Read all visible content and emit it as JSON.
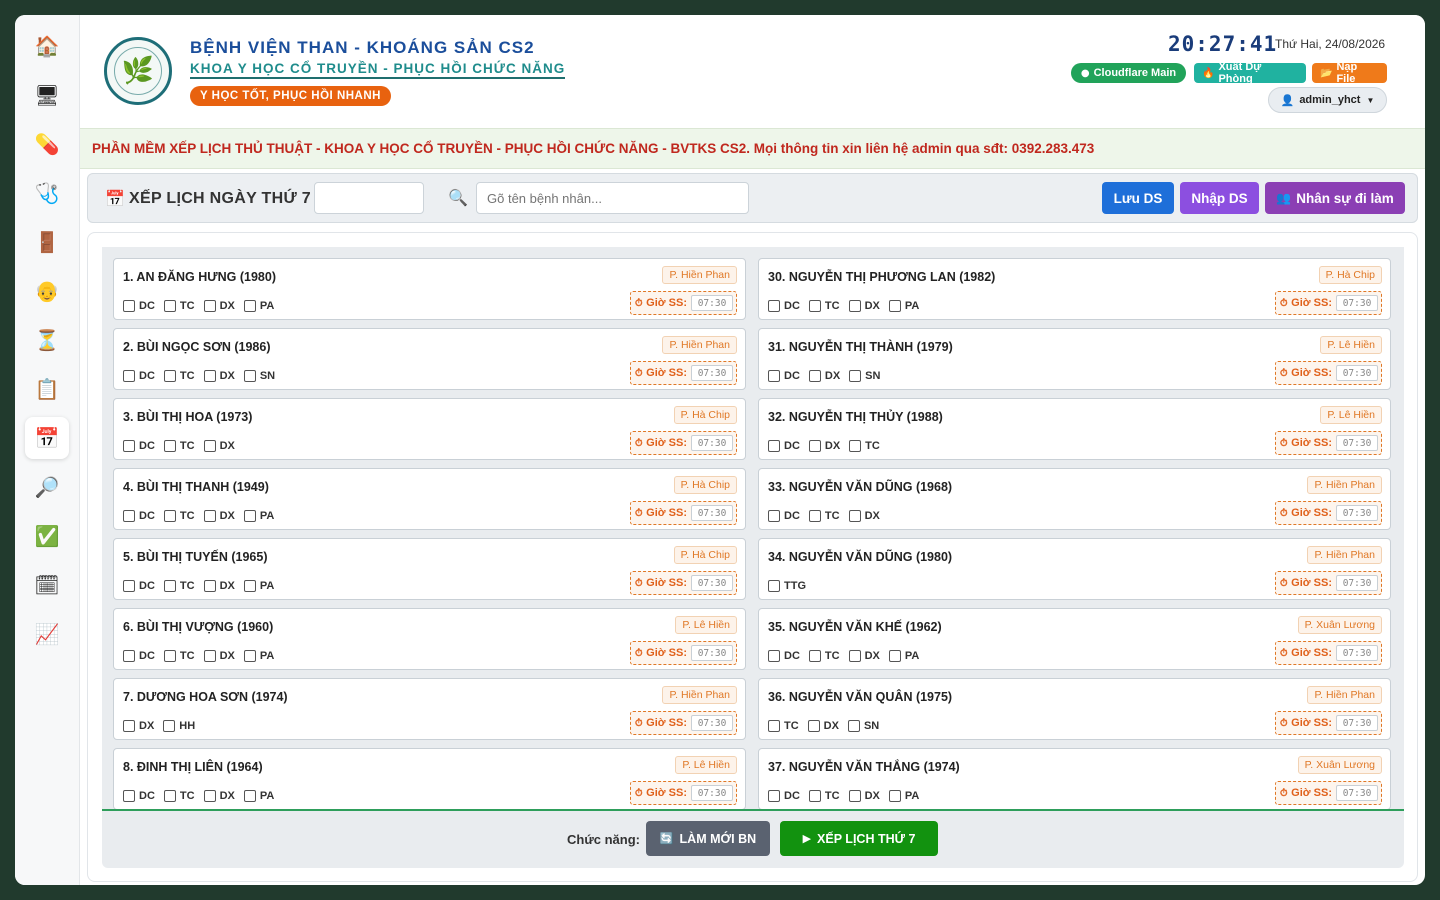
{
  "sidebar": {
    "items": [
      {
        "icon": "home-icon",
        "glyph": "🏠"
      },
      {
        "icon": "monitor-icon",
        "glyph": "🖥"
      },
      {
        "icon": "pill-icon",
        "glyph": "💊"
      },
      {
        "icon": "stethoscope-icon",
        "glyph": "🩺"
      },
      {
        "icon": "door-icon",
        "glyph": "🚪"
      },
      {
        "icon": "elderly-icon",
        "glyph": "👴"
      },
      {
        "icon": "hourglass-icon",
        "glyph": "⏳"
      },
      {
        "icon": "clipboard-icon",
        "glyph": "📋"
      },
      {
        "icon": "calendar-icon",
        "glyph": "📅"
      },
      {
        "icon": "search-icon",
        "glyph": "🔎"
      },
      {
        "icon": "check-icon",
        "glyph": "✅"
      },
      {
        "icon": "calendar-grid-icon",
        "glyph": "🗓"
      },
      {
        "icon": "chart-icon",
        "glyph": "📈"
      }
    ]
  },
  "header": {
    "hospital": "BỆNH VIỆN THAN - KHOÁNG SẢN CS2",
    "department": "KHOA Y HỌC CỔ TRUYỀN - PHỤC HỒI CHỨC NĂNG",
    "slogan": "Y HỌC TỐT, PHỤC HỒI NHANH",
    "clock": "20:27:41",
    "date": "Thứ Hai, 24/08/2026",
    "btn_cloudflare": "Cloudflare Main",
    "btn_export": "Xuất Dự Phòng",
    "btn_load": "Nạp File",
    "user": "admin_yhct"
  },
  "notice": "PHẦN MỀM XẾP LỊCH THỦ THUẬT - KHOA Y HỌC CỔ TRUYỀN - PHỤC HỒI CHỨC NĂNG - BVTKS CS2. Mọi thông tin xin liên hệ admin qua sđt: 0392.283.473",
  "toolbar": {
    "title": "XẾP LỊCH NGÀY THỨ 7",
    "date_value": "",
    "search_placeholder": "Gõ tên bệnh nhân...",
    "save_label": "Lưu DS",
    "import_label": "Nhập DS",
    "staff_label": "Nhân sự đi làm"
  },
  "time_label": "Giờ SS:",
  "default_time": "07:30",
  "patients_left": [
    {
      "name": "1. AN ĐĂNG HƯNG (1980)",
      "staff": "P. Hiền Phan",
      "checks": [
        "DC",
        "TC",
        "DX",
        "PA"
      ]
    },
    {
      "name": "2. BÙI NGỌC SƠN (1986)",
      "staff": "P. Hiền Phan",
      "checks": [
        "DC",
        "TC",
        "DX",
        "SN"
      ]
    },
    {
      "name": "3. BÙI THỊ HOA (1973)",
      "staff": "P. Hà Chip",
      "checks": [
        "DC",
        "TC",
        "DX"
      ]
    },
    {
      "name": "4. BÙI THỊ THANH (1949)",
      "staff": "P. Hà Chip",
      "checks": [
        "DC",
        "TC",
        "DX",
        "PA"
      ]
    },
    {
      "name": "5. BÙI THỊ TUYẾN (1965)",
      "staff": "P. Hà Chip",
      "checks": [
        "DC",
        "TC",
        "DX",
        "PA"
      ]
    },
    {
      "name": "6. BÙI THỊ VƯỢNG (1960)",
      "staff": "P. Lê Hiền",
      "checks": [
        "DC",
        "TC",
        "DX",
        "PA"
      ]
    },
    {
      "name": "7. DƯƠNG HOA SƠN (1974)",
      "staff": "P. Hiền Phan",
      "checks": [
        "DX",
        "HH"
      ]
    },
    {
      "name": "8. ĐINH THỊ LIÊN (1964)",
      "staff": "P. Lê Hiền",
      "checks": [
        "DC",
        "TC",
        "DX",
        "PA"
      ]
    }
  ],
  "patients_right": [
    {
      "name": "30. NGUYỄN THỊ PHƯƠNG LAN (1982)",
      "staff": "P. Hà Chip",
      "checks": [
        "DC",
        "TC",
        "DX",
        "PA"
      ]
    },
    {
      "name": "31. NGUYỄN THỊ THÀNH (1979)",
      "staff": "P. Lê Hiền",
      "checks": [
        "DC",
        "DX",
        "SN"
      ]
    },
    {
      "name": "32. NGUYỄN THỊ THỦY (1988)",
      "staff": "P. Lê Hiền",
      "checks": [
        "DC",
        "DX",
        "TC"
      ]
    },
    {
      "name": "33. NGUYỄN VĂN DŨNG (1968)",
      "staff": "P. Hiền Phan",
      "checks": [
        "DC",
        "TC",
        "DX"
      ]
    },
    {
      "name": "34. NGUYỄN VĂN DŨNG (1980)",
      "staff": "P. Hiền Phan",
      "checks": [
        "TTG"
      ]
    },
    {
      "name": "35. NGUYỄN VĂN KHẾ (1962)",
      "staff": "P. Xuân Lương",
      "checks": [
        "DC",
        "TC",
        "DX",
        "PA"
      ]
    },
    {
      "name": "36. NGUYỄN VĂN QUÂN (1975)",
      "staff": "P. Hiền Phan",
      "checks": [
        "TC",
        "DX",
        "SN"
      ]
    },
    {
      "name": "37. NGUYỄN VĂN THẮNG (1974)",
      "staff": "P. Xuân Lương",
      "checks": [
        "DC",
        "TC",
        "DX",
        "PA"
      ]
    }
  ],
  "footer": {
    "label": "Chức năng:",
    "refresh_label": "LÀM MỚI BN",
    "schedule_label": "XẾP LỊCH THỨ 7"
  },
  "colors": {
    "primary_blue": "#1b4e9b",
    "notice_red": "#c0281e",
    "save_btn": "#1e6fd9",
    "import_btn": "#8c4fe0",
    "staff_btn": "#8b3fb4",
    "schedule_btn": "#12920f",
    "refresh_btn": "#5a6270",
    "cloudflare_btn": "#21a35a",
    "export_btn": "#20b2a0",
    "load_btn": "#ef7a1a"
  }
}
